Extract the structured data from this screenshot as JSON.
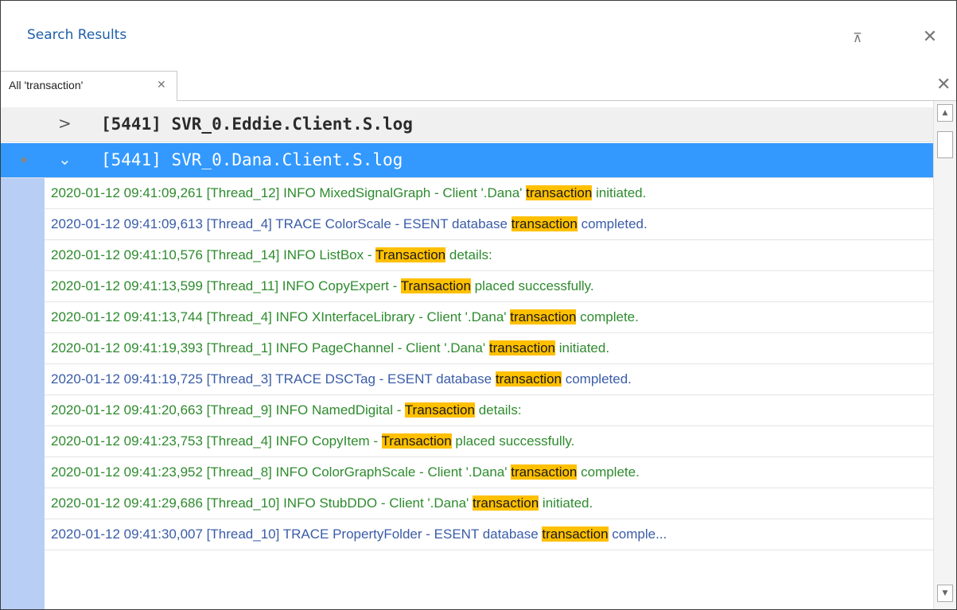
{
  "panel": {
    "title": "Search Results",
    "pin_glyph": "⊼",
    "close_glyph": "✕"
  },
  "tabs": [
    {
      "label": "All 'transaction'",
      "close_glyph": "✕",
      "active": true
    }
  ],
  "tab_strip_close_glyph": "✕",
  "groups": [
    {
      "label": "[5441] SVR_0.Eddie.Client.S.log",
      "expanded": false,
      "selected": false,
      "chevron": ">"
    },
    {
      "label": "[5441] SVR_0.Dana.Client.S.log",
      "expanded": true,
      "selected": true,
      "chevron": "⌄"
    }
  ],
  "highlight_color": "#ffc000",
  "log_lines": [
    {
      "level": "info",
      "pre": "2020-01-12 09:41:09,261 [Thread_12] INFO  MixedSignalGraph - Client '.Dana' ",
      "hit": "transaction",
      "post": " initiated."
    },
    {
      "level": "trace",
      "pre": "2020-01-12 09:41:09,613 [Thread_4] TRACE ColorScale - ESENT database ",
      "hit": "transaction",
      "post": " completed."
    },
    {
      "level": "info",
      "pre": "2020-01-12 09:41:10,576 [Thread_14] INFO  ListBox - ",
      "hit": "Transaction",
      "post": " details:"
    },
    {
      "level": "info",
      "pre": "2020-01-12 09:41:13,599 [Thread_11] INFO  CopyExpert - ",
      "hit": "Transaction",
      "post": " placed successfully."
    },
    {
      "level": "info",
      "pre": "2020-01-12 09:41:13,744 [Thread_4] INFO  XInterfaceLibrary - Client '.Dana' ",
      "hit": "transaction",
      "post": " complete."
    },
    {
      "level": "info",
      "pre": "2020-01-12 09:41:19,393 [Thread_1] INFO  PageChannel - Client '.Dana' ",
      "hit": "transaction",
      "post": " initiated."
    },
    {
      "level": "trace",
      "pre": "2020-01-12 09:41:19,725 [Thread_3] TRACE DSCTag - ESENT database ",
      "hit": "transaction",
      "post": " completed."
    },
    {
      "level": "info",
      "pre": "2020-01-12 09:41:20,663 [Thread_9] INFO  NamedDigital - ",
      "hit": "Transaction",
      "post": " details:"
    },
    {
      "level": "info",
      "pre": "2020-01-12 09:41:23,753 [Thread_4] INFO  CopyItem - ",
      "hit": "Transaction",
      "post": " placed successfully."
    },
    {
      "level": "info",
      "pre": "2020-01-12 09:41:23,952 [Thread_8] INFO  ColorGraphScale - Client '.Dana' ",
      "hit": "transaction",
      "post": " complete."
    },
    {
      "level": "info",
      "pre": "2020-01-12 09:41:29,686 [Thread_10] INFO  StubDDO - Client '.Dana' ",
      "hit": "transaction",
      "post": " initiated."
    },
    {
      "level": "trace",
      "pre": "2020-01-12 09:41:30,007 [Thread_10] TRACE PropertyFolder - ESENT database ",
      "hit": "transaction",
      "post": " comple..."
    }
  ],
  "scrollbar": {
    "up_glyph": "▲",
    "down_glyph": "▼"
  }
}
